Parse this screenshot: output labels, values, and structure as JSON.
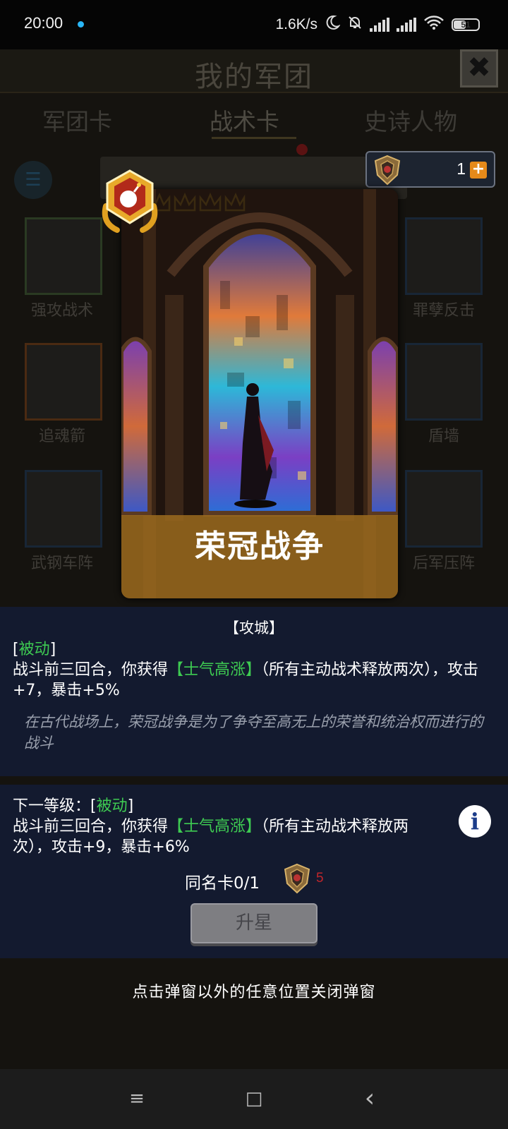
{
  "status_bar": {
    "time": "20:00",
    "network_speed": "1.6K/s",
    "battery_level": "51",
    "icons": [
      "notification-dot",
      "moon-icon",
      "bell-off-icon",
      "signal-icon",
      "signal-icon",
      "wifi-icon",
      "battery-icon"
    ]
  },
  "background": {
    "title": "我的军团",
    "close_label": "✖",
    "tabs": [
      {
        "label": "军团卡"
      },
      {
        "label": "战术卡"
      },
      {
        "label": "史诗人物"
      }
    ],
    "left_cards": [
      {
        "label": "强攻战术"
      },
      {
        "label": "追魂箭"
      },
      {
        "label": "武钢车阵"
      }
    ],
    "right_cards": [
      {
        "label": "罪孽反击"
      },
      {
        "label": "盾墙"
      },
      {
        "label": "后军压阵"
      }
    ]
  },
  "currency": {
    "count": "1",
    "add_label": "+"
  },
  "card": {
    "name": "荣冠战争",
    "badge_icon": "bomb-icon",
    "star_count": 5
  },
  "description": {
    "category": "【攻城】",
    "bracket_open": "[",
    "type": "被动",
    "bracket_close": "]",
    "effect_prefix": "战斗前三回合，你获得",
    "buff_name": "【士气高涨】",
    "effect_suffix": "（所有主动战术释放两次），攻击+7，暴击+5%",
    "flavor": "在古代战场上，荣冠战争是为了争夺至高无上的荣誉和统治权而进行的战斗"
  },
  "next_level": {
    "label": "下一等级：[",
    "type": "被动",
    "bracket_close": "]",
    "effect_prefix": "战斗前三回合，你获得",
    "buff_name": "【士气高涨】",
    "effect_suffix": "（所有主动战术释放两次），攻击+9，暴击+6%",
    "info_label": "i"
  },
  "duplicate": {
    "label": "同名卡0/1",
    "count": "5"
  },
  "upgrade_button": "升星",
  "close_hint": "点击弹窗以外的任意位置关闭弹窗",
  "nav": {
    "menu": "≡",
    "home": "□",
    "back": "‹"
  },
  "colors": {
    "panel": "#131a2f",
    "green_text": "#3ecb52",
    "banner": "#a06e1e",
    "duplicate_count": "#c0262b"
  }
}
